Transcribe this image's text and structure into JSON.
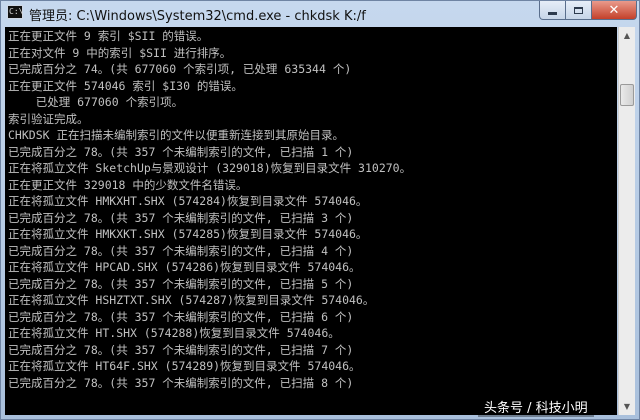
{
  "window": {
    "title": "管理员: C:\\Windows\\System32\\cmd.exe - chkdsk  K:/f",
    "icon": "cmd-icon",
    "icon_glyph": "C:\\",
    "controls": {
      "minimize_icon": "minimize-icon",
      "maximize_icon": "maximize-icon",
      "close_icon": "close-icon",
      "close_glyph": "✕"
    }
  },
  "console": {
    "lines": [
      "正在更正文件 9 索引 $SII 的错误。",
      "正在对文件 9 中的索引 $SII 进行排序。",
      "已完成百分之 74。(共 677060 个索引项, 已处理 635344 个)",
      "正在更正文件 574046 索引 $I30 的错误。",
      "    已处理 677060 个索引项。",
      "索引验证完成。",
      "CHKDSK 正在扫描未编制索引的文件以便重新连接到其原始目录。",
      "已完成百分之 78。(共 357 个未编制索引的文件, 已扫描 1 个)",
      "正在将孤立文件 SketchUp与景观设计 (329018)恢复到目录文件 310270。",
      "正在更正文件 329018 中的少数文件名错误。",
      "正在将孤立文件 HMKXHT.SHX (574284)恢复到目录文件 574046。",
      "已完成百分之 78。(共 357 个未编制索引的文件, 已扫描 3 个)",
      "正在将孤立文件 HMKXKT.SHX (574285)恢复到目录文件 574046。",
      "已完成百分之 78。(共 357 个未编制索引的文件, 已扫描 4 个)",
      "正在将孤立文件 HPCAD.SHX (574286)恢复到目录文件 574046。",
      "已完成百分之 78。(共 357 个未编制索引的文件, 已扫描 5 个)",
      "正在将孤立文件 HSHZTXT.SHX (574287)恢复到目录文件 574046。",
      "已完成百分之 78。(共 357 个未编制索引的文件, 已扫描 6 个)",
      "正在将孤立文件 HT.SHX (574288)恢复到目录文件 574046。",
      "已完成百分之 78。(共 357 个未编制索引的文件, 已扫描 7 个)",
      "正在将孤立文件 HT64F.SHX (574289)恢复到目录文件 574046。",
      "已完成百分之 78。(共 357 个未编制索引的文件, 已扫描 8 个)"
    ],
    "colors": {
      "background": "#000000",
      "text": "#c0c0c0"
    }
  },
  "scrollbar": {
    "up_icon": "scroll-up-arrow-icon",
    "down_icon": "scroll-down-arrow-icon",
    "up_glyph": "▲",
    "down_glyph": "▼",
    "position": 0.12
  },
  "watermark": {
    "text": "头条号 / 科技小明"
  }
}
